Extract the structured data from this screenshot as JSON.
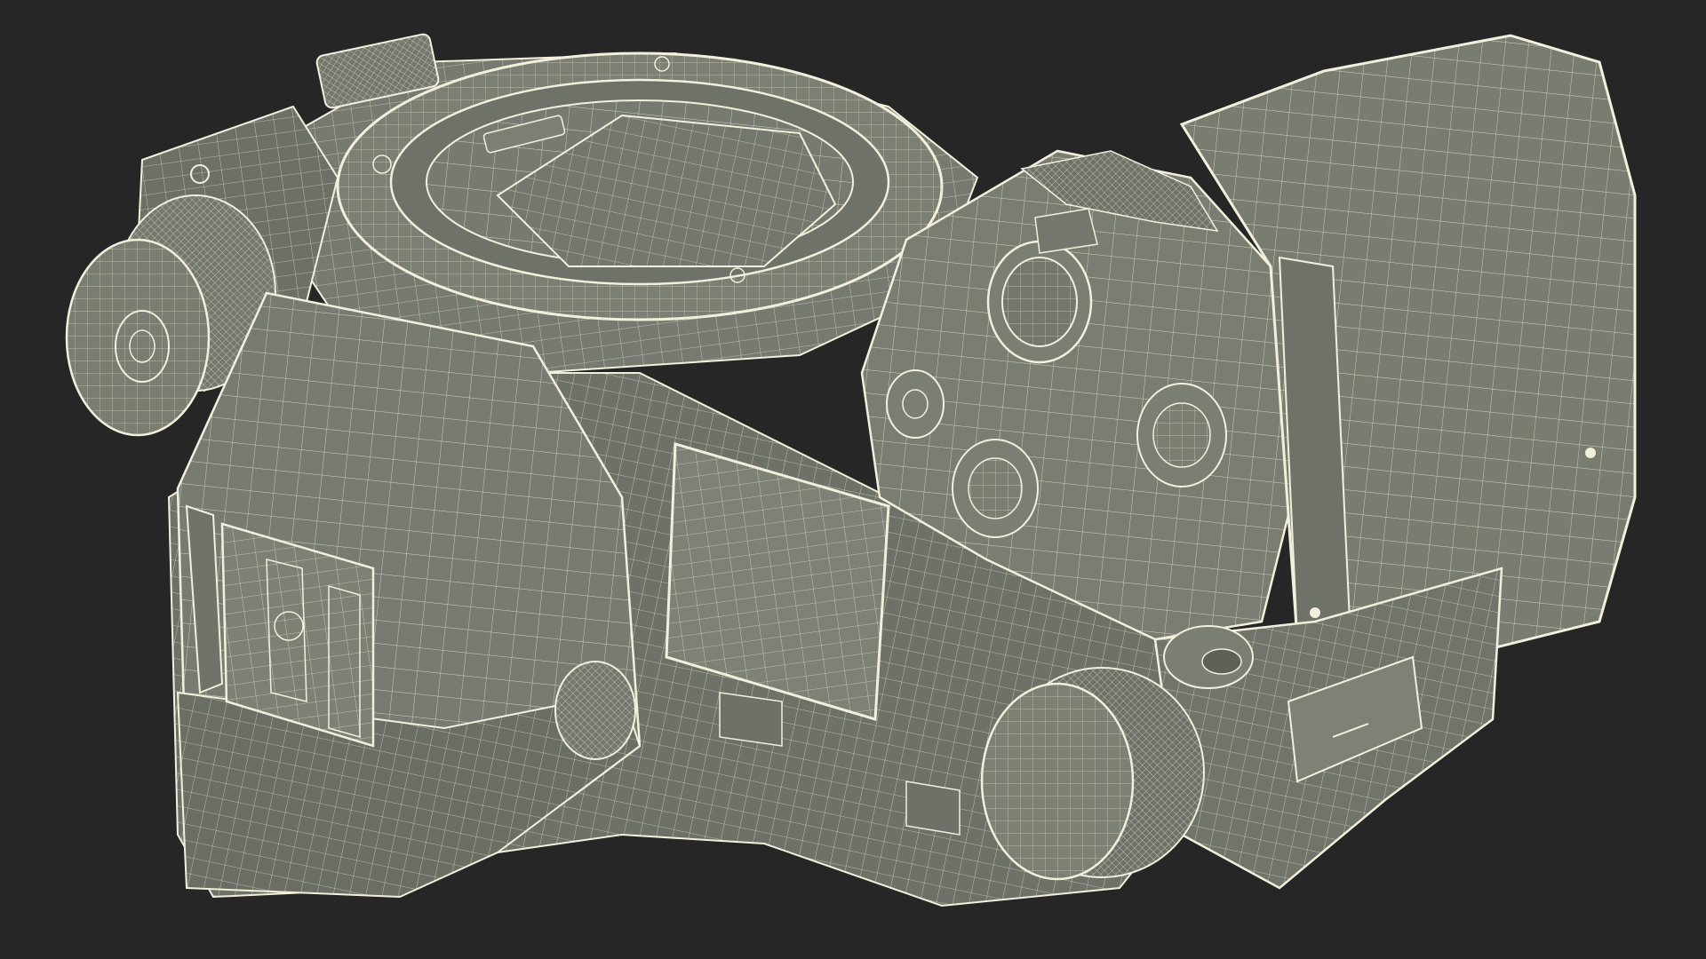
{
  "scene": {
    "subject": "camera-body-wireframe-render",
    "background_color": "#262626",
    "surface_color": "#777a70",
    "surface_shadow_color": "#5d6057",
    "wire_color": "#f2f0dc"
  }
}
